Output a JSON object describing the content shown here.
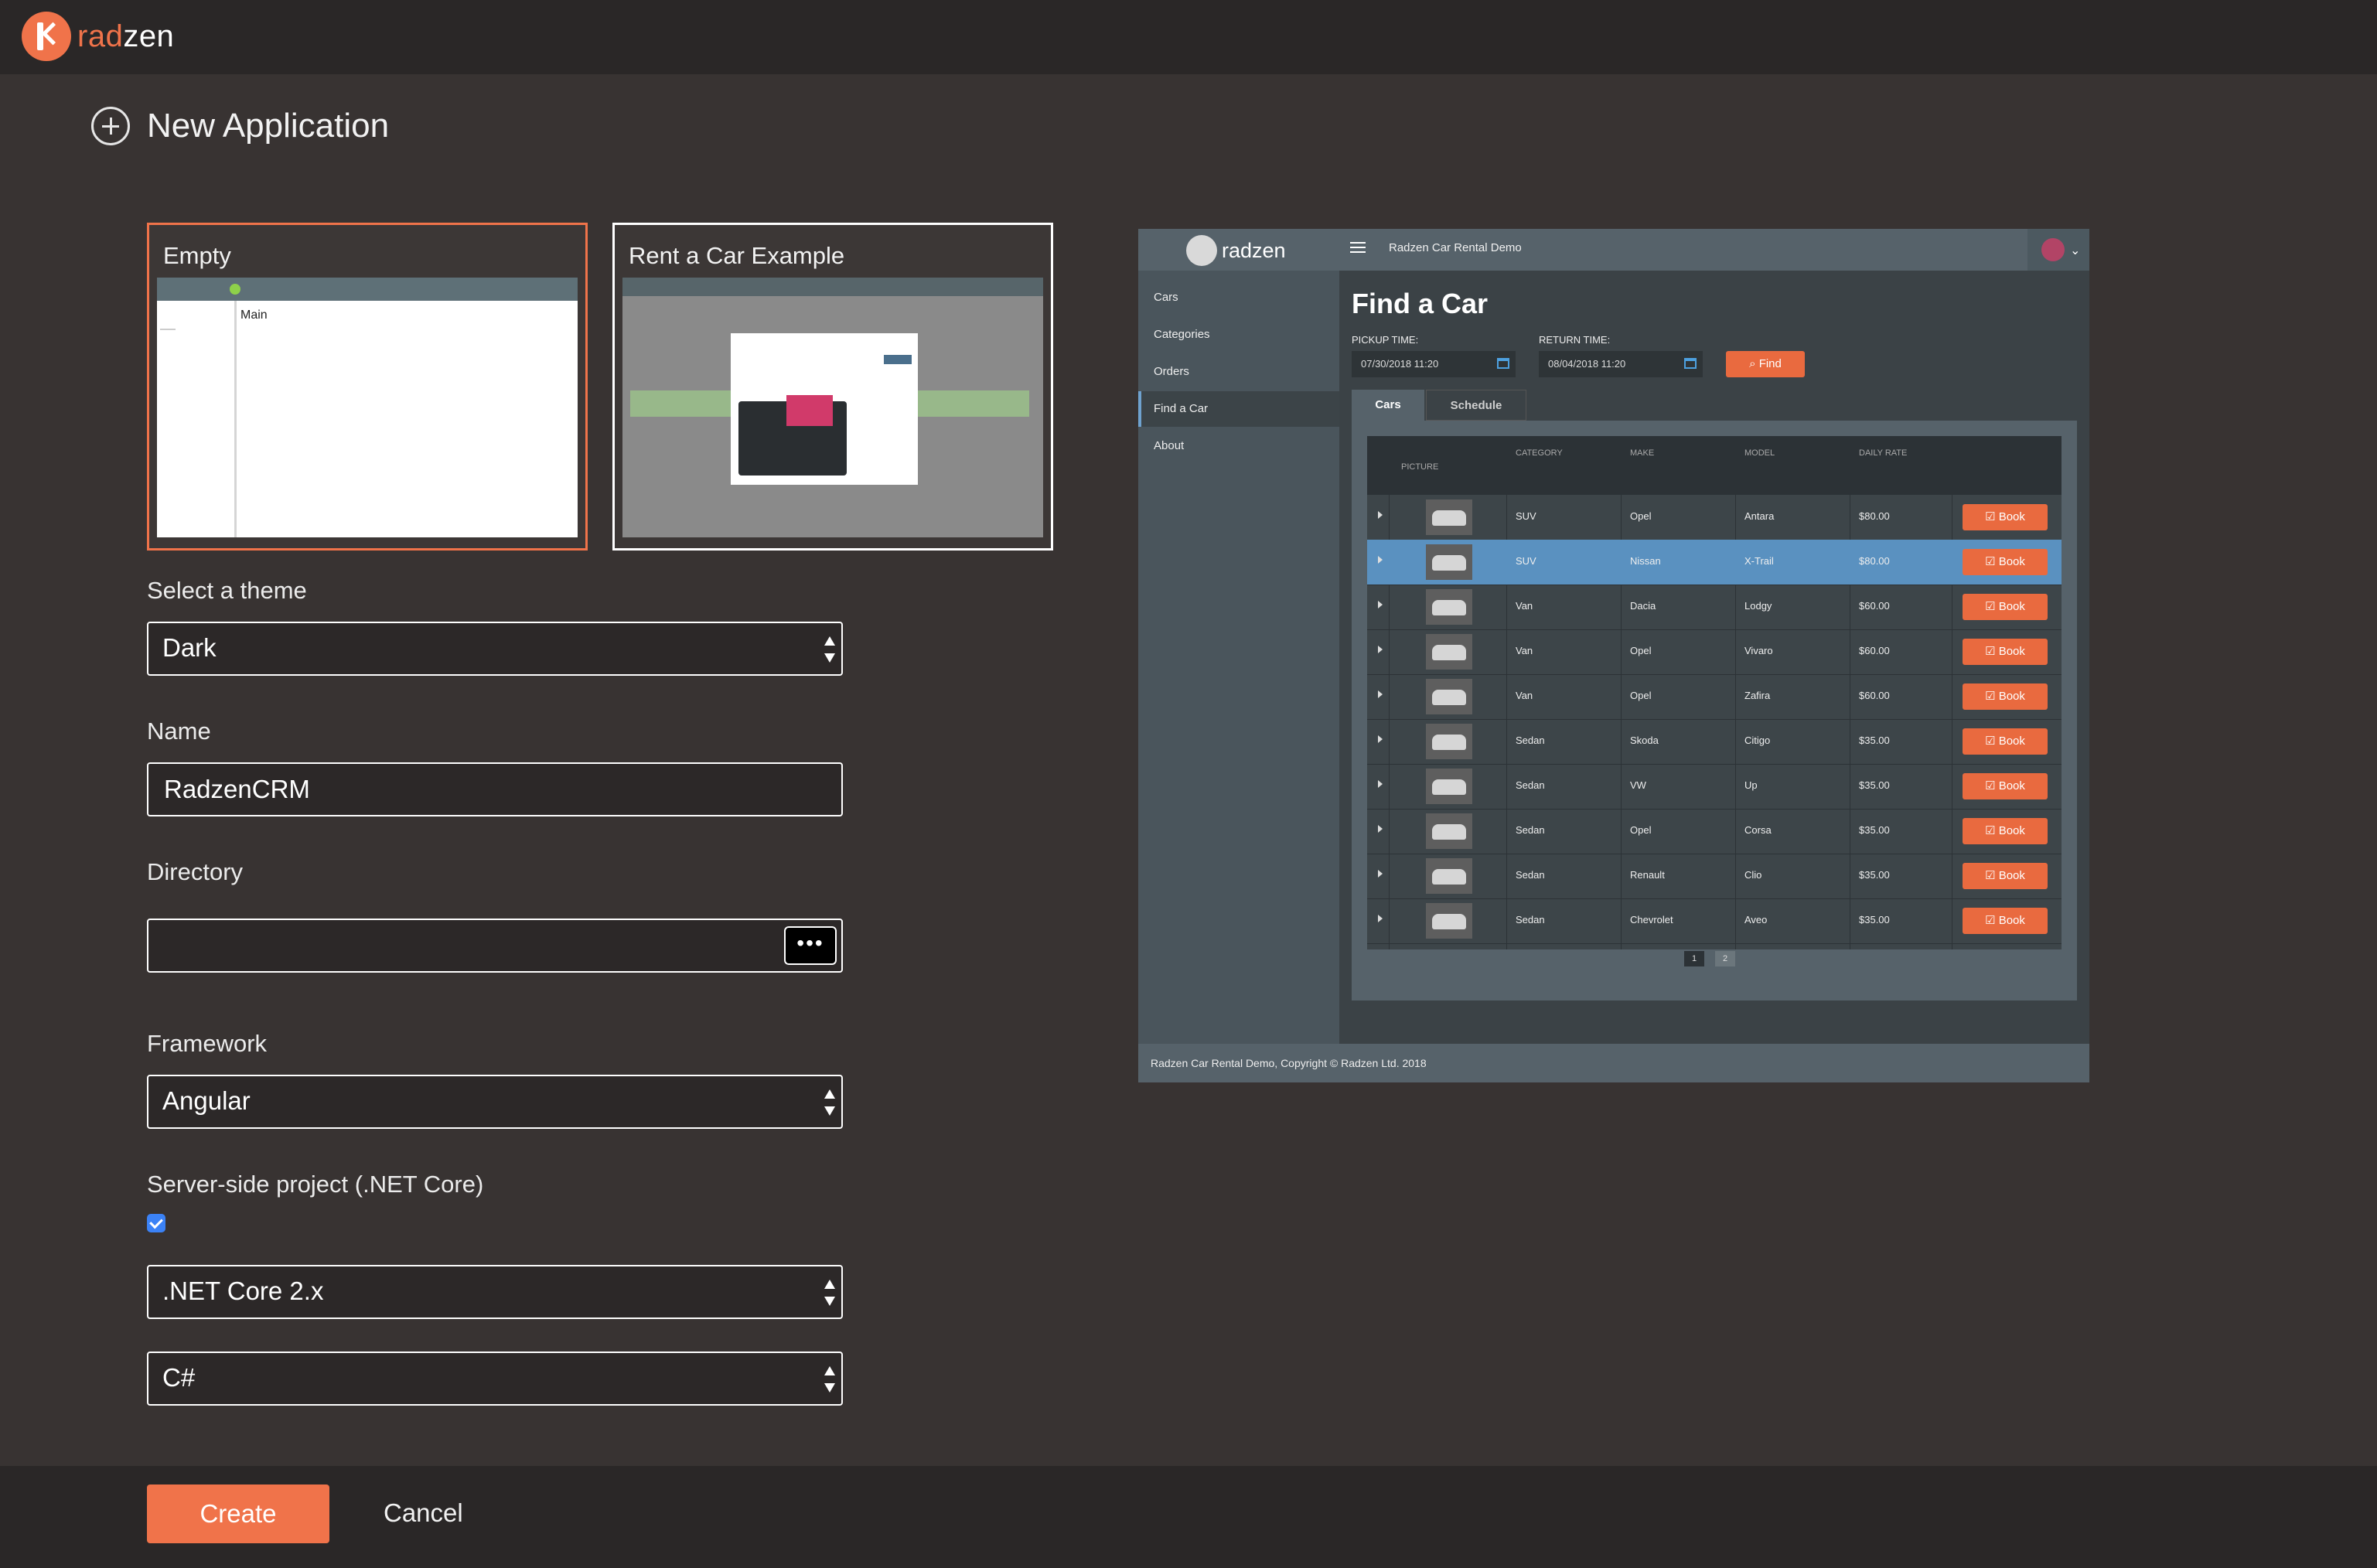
{
  "brand": {
    "name_prefix": "rad",
    "name_suffix": "zen"
  },
  "page": {
    "title": "New Application"
  },
  "templates": [
    {
      "title": "Empty",
      "main_label": "Main",
      "selected": true
    },
    {
      "title": "Rent a Car Example",
      "selected": false
    }
  ],
  "theme": {
    "label": "Select a theme",
    "value": "Dark"
  },
  "name_field": {
    "label": "Name",
    "value": "RadzenCRM"
  },
  "directory": {
    "label": "Directory",
    "value": "",
    "browse_label": "•••"
  },
  "framework": {
    "label": "Framework",
    "value": "Angular"
  },
  "server_side": {
    "label": "Server-side project (.NET Core)",
    "checked": true
  },
  "dotnet_version": {
    "value": ".NET Core 2.x"
  },
  "language": {
    "value": "C#"
  },
  "actions": {
    "create": "Create",
    "cancel": "Cancel"
  },
  "colors": {
    "accent": "#f0734a",
    "background": "#383332",
    "bar": "#2a2727",
    "selected_row": "#5a91c0"
  },
  "preview": {
    "logo": "radzen",
    "app_title": "Radzen Car Rental Demo",
    "nav": [
      "Cars",
      "Categories",
      "Orders",
      "Find a Car",
      "About"
    ],
    "active_nav": "Find a Car",
    "heading": "Find a Car",
    "pickup_label": "PICKUP TIME:",
    "pickup_value": "07/30/2018 11:20",
    "return_label": "RETURN TIME:",
    "return_value": "08/04/2018 11:20",
    "find_label": "Find",
    "tabs": [
      "Cars",
      "Schedule"
    ],
    "columns": [
      "PICTURE",
      "CATEGORY",
      "MAKE",
      "MODEL",
      "DAILY RATE"
    ],
    "book_label": "Book",
    "rows": [
      {
        "category": "SUV",
        "make": "Opel",
        "model": "Antara",
        "rate": "$80.00"
      },
      {
        "category": "SUV",
        "make": "Nissan",
        "model": "X-Trail",
        "rate": "$80.00"
      },
      {
        "category": "Van",
        "make": "Dacia",
        "model": "Lodgy",
        "rate": "$60.00"
      },
      {
        "category": "Van",
        "make": "Opel",
        "model": "Vivaro",
        "rate": "$60.00"
      },
      {
        "category": "Van",
        "make": "Opel",
        "model": "Zafira",
        "rate": "$60.00"
      },
      {
        "category": "Sedan",
        "make": "Skoda",
        "model": "Citigo",
        "rate": "$35.00"
      },
      {
        "category": "Sedan",
        "make": "VW",
        "model": "Up",
        "rate": "$35.00"
      },
      {
        "category": "Sedan",
        "make": "Opel",
        "model": "Corsa",
        "rate": "$35.00"
      },
      {
        "category": "Sedan",
        "make": "Renault",
        "model": "Clio",
        "rate": "$35.00"
      },
      {
        "category": "Sedan",
        "make": "Chevrolet",
        "model": "Aveo",
        "rate": "$35.00"
      }
    ],
    "selected_row": 1,
    "pages": [
      "1",
      "2"
    ],
    "footer": "Radzen Car Rental Demo, Copyright © Radzen Ltd. 2018"
  }
}
